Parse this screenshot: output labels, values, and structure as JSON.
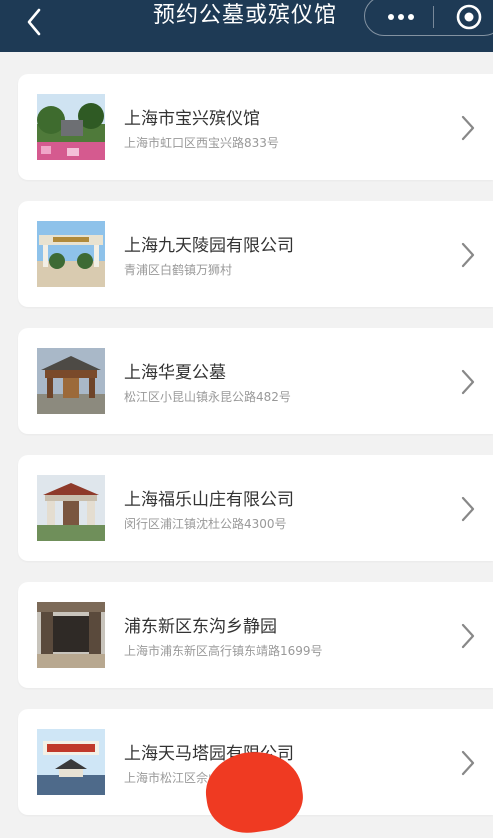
{
  "header": {
    "title": "预约公墓或殡仪馆",
    "back_icon": "chevron-left-icon",
    "more_icon": "more-dots-icon",
    "close_icon": "target-close-icon",
    "background": "#1e3a55"
  },
  "venues": [
    {
      "name": "上海市宝兴殡仪馆",
      "address": "上海市虹口区西宝兴路833号"
    },
    {
      "name": "上海九天陵园有限公司",
      "address": "青浦区白鹤镇万狮村"
    },
    {
      "name": "上海华夏公墓",
      "address": "松江区小昆山镇永昆公路482号"
    },
    {
      "name": "上海福乐山庄有限公司",
      "address": "闵行区浦江镇沈杜公路4300号"
    },
    {
      "name": "浦东新区东沟乡静园",
      "address": "上海市浦东新区高行镇东靖路1699号"
    },
    {
      "name": "上海天马塔园有限公司",
      "address": "上海市松江区佘山镇3645号"
    }
  ],
  "colors": {
    "name": "#333333",
    "address": "#999999",
    "chevron": "#888888",
    "page_bg": "#f2f2f2"
  }
}
